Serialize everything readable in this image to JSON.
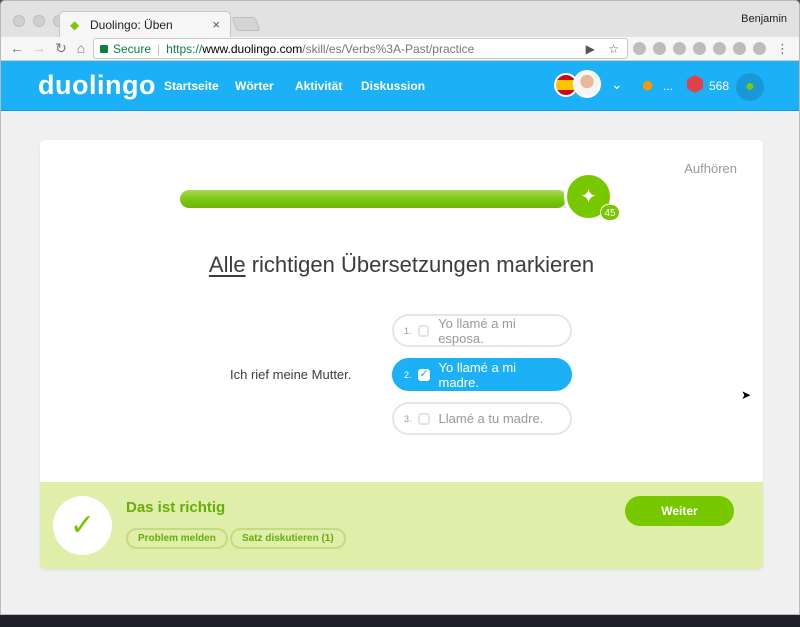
{
  "browser": {
    "tab_title": "Duolingo: Üben",
    "tab_close": "×",
    "profile_name": "Benjamin",
    "back": "←",
    "forward": "→",
    "reload": "↻",
    "home": "⌂",
    "secure_label": "Secure",
    "url_protocol": "https://",
    "url_domain": "www.duolingo.com",
    "url_path": "/skill/es/Verbs%3A-Past/practice",
    "camera_icon": "▶",
    "star_icon": "☆",
    "menu_icon": "⋮"
  },
  "header": {
    "logo": "duolingo",
    "nav": [
      "Startseite",
      "Wörter",
      "Aktivität",
      "Diskussion"
    ],
    "chevron": "⌄",
    "streak_icon": "●",
    "streak_dots": "...",
    "gems": "568",
    "bell_icon": "●"
  },
  "lesson": {
    "quit": "Aufhören",
    "progress": 0.92,
    "badge_icon": "✦",
    "badge_count": "45",
    "instruction_emph": "Alle",
    "instruction_rest": " richtigen Übersetzungen markieren",
    "prompt": "Ich rief meine Mutter.",
    "choices": [
      {
        "num": "1.",
        "text": "Yo llamé a mi esposa.",
        "selected": false
      },
      {
        "num": "2.",
        "text": "Yo llamé a mi madre.",
        "selected": true,
        "check": "✓"
      },
      {
        "num": "3.",
        "text": "Llamé a tu madre.",
        "selected": false
      }
    ]
  },
  "footer": {
    "check_icon": "✓",
    "title": "Das ist richtig",
    "report_button": "Problem melden",
    "discuss_button": "Satz diskutieren (1)",
    "next_button": "Weiter"
  },
  "cursor_icon": "➤"
}
